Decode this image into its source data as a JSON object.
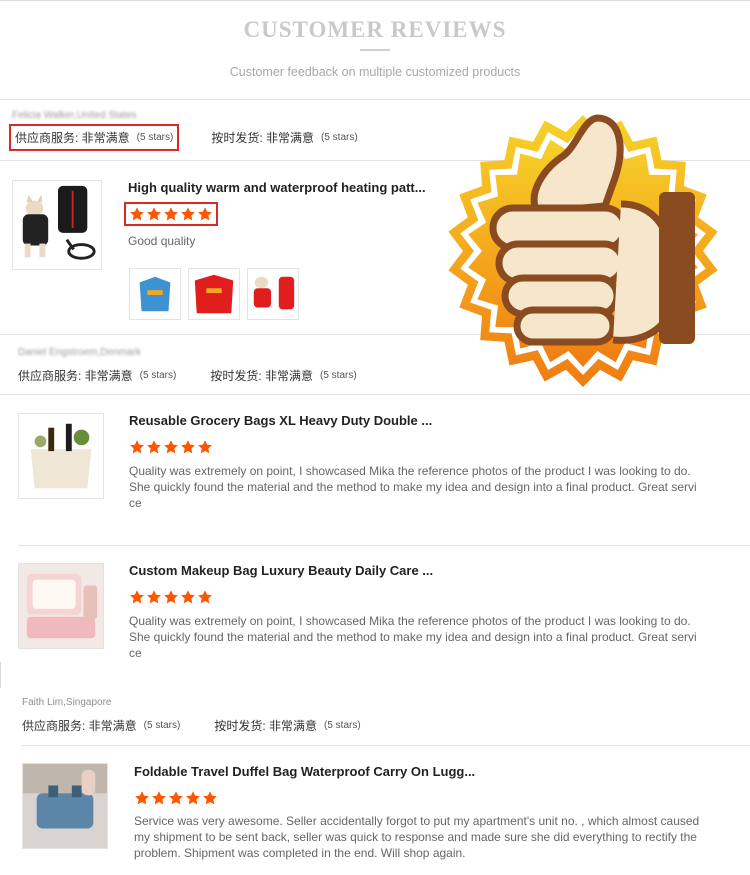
{
  "header": {
    "title": "CUSTOMER REVIEWS",
    "subtitle": "Customer feedback on multiple customized products"
  },
  "colors": {
    "star": "#ff5500",
    "highlight_box": "#d62b2b",
    "badge_outer": "#f7a21c",
    "badge_inner": "#ffffff"
  },
  "badge": {
    "icon": "thumbs-up-icon"
  },
  "reviews": [
    {
      "reviewer": "Felicia Walker,United States",
      "supplier_label": "供应商服务: 非常满意",
      "supplier_stars": "(5 stars)",
      "shipping_label": "按时发货: 非常满意",
      "shipping_stars": "(5 stars)",
      "items": [
        {
          "title": "High quality warm and waterproof heating patt...",
          "rating": 5,
          "text": "Good quality",
          "photos": [
            "blue-coat-photo",
            "red-coat-photo",
            "dog-in-red-coat-photo"
          ]
        }
      ]
    },
    {
      "reviewer": "Daniel Engstroem,Denmark",
      "supplier_label": "供应商服务: 非常满意",
      "supplier_stars": "(5 stars)",
      "shipping_label": "按时发货: 非常满意",
      "shipping_stars": "(5 stars)",
      "items": [
        {
          "title": "Reusable Grocery Bags XL Heavy Duty Double ...",
          "rating": 5,
          "text_lines": [
            "Quality was extremely on point, I showcased Mika the reference photos of the product I was looking to do.",
            "She quickly found the material and the method to make my idea and design into a final product. Great servi",
            "ce"
          ]
        },
        {
          "title": "Custom Makeup Bag Luxury Beauty Daily Care ...",
          "rating": 5,
          "text_lines": [
            "Quality was extremely on point, I showcased Mika the reference photos of the product I was looking to do.",
            "She quickly found the material and the method to make my idea and design into a final product. Great servi",
            "ce"
          ]
        }
      ]
    },
    {
      "reviewer": "Faith Lim,Singapore",
      "supplier_label": "供应商服务: 非常满意",
      "supplier_stars": "(5 stars)",
      "shipping_label": "按时发货: 非常满意",
      "shipping_stars": "(5 stars)",
      "items": [
        {
          "title": "Foldable Travel Duffel Bag Waterproof Carry On Lugg...",
          "rating": 5,
          "text_lines": [
            "Service was very awesome. Seller accidentally forgot to put my apartment's unit no. , which almost caused",
            "my shipment to be sent back, seller was quick to response and made sure she did everything to rectify the",
            "problem. Shipment was completed in the end. Will shop again."
          ]
        }
      ]
    }
  ]
}
